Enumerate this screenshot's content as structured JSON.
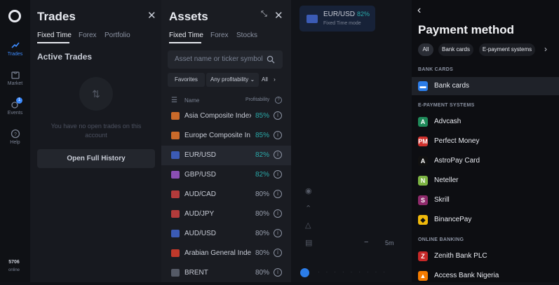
{
  "rail": {
    "items": [
      {
        "label": "Trades",
        "icon": "trades-icon"
      },
      {
        "label": "Market",
        "icon": "market-icon"
      },
      {
        "label": "Events",
        "icon": "events-icon",
        "badge": "1"
      },
      {
        "label": "Help",
        "icon": "help-icon"
      }
    ],
    "online_count": "5706",
    "online_label": "online"
  },
  "trades": {
    "title": "Trades",
    "tabs": [
      "Fixed Time",
      "Forex",
      "Portfolio"
    ],
    "section": "Active Trades",
    "empty_text": "You have no open trades on this account",
    "history_button": "Open Full History"
  },
  "assets": {
    "title": "Assets",
    "tabs": [
      "Fixed Time",
      "Forex",
      "Stocks"
    ],
    "search_placeholder": "Asset name or ticker symbol",
    "filters": [
      "Favorites",
      "Any profitability",
      "All"
    ],
    "col_name": "Name",
    "col_profit": "Profitability",
    "rows": [
      {
        "name": "Asia Composite Index",
        "pct": "85%",
        "color": "#c96a2a",
        "highlight": true
      },
      {
        "name": "Europe Composite In...",
        "pct": "85%",
        "color": "#c96a2a",
        "highlight": true
      },
      {
        "name": "EUR/USD",
        "pct": "82%",
        "color": "#3b5bb5",
        "highlight": true,
        "selected": true
      },
      {
        "name": "GBP/USD",
        "pct": "82%",
        "color": "#8a4fb3",
        "highlight": true
      },
      {
        "name": "AUD/CAD",
        "pct": "80%",
        "color": "#b33b3b",
        "highlight": false
      },
      {
        "name": "AUD/JPY",
        "pct": "80%",
        "color": "#b33b3b",
        "highlight": false
      },
      {
        "name": "AUD/USD",
        "pct": "80%",
        "color": "#3b5bb5",
        "highlight": false
      },
      {
        "name": "Arabian General Index",
        "pct": "80%",
        "color": "#c0392b",
        "highlight": false
      },
      {
        "name": "BRENT",
        "pct": "80%",
        "color": "#555a66",
        "highlight": false
      }
    ]
  },
  "chart": {
    "pair": "EUR/USD",
    "pair_pct": "82%",
    "mode": "Fixed Time mode",
    "timeframe": "5m",
    "zoom_minus": "−"
  },
  "payment": {
    "title": "Payment method",
    "chips": [
      "All",
      "Bank cards",
      "E-payment systems"
    ],
    "sections": {
      "bank": "BANK CARDS",
      "epay": "E-PAYMENT SYSTEMS",
      "online": "ONLINE BANKING"
    },
    "bank_items": [
      {
        "label": "Bank cards",
        "color": "#2b7de9",
        "glyph": "▬"
      }
    ],
    "epay_items": [
      {
        "label": "Advcash",
        "color": "#1f8a5a",
        "glyph": "A"
      },
      {
        "label": "Perfect Money",
        "color": "#d0312d",
        "glyph": "PM"
      },
      {
        "label": "AstroPay Card",
        "color": "#111111",
        "glyph": "A"
      },
      {
        "label": "Neteller",
        "color": "#7cb342",
        "glyph": "N"
      },
      {
        "label": "Skrill",
        "color": "#8e2a6b",
        "glyph": "S"
      },
      {
        "label": "BinancePay",
        "color": "#f0b90b",
        "glyph": "◆"
      }
    ],
    "online_items": [
      {
        "label": "Zenith Bank PLC",
        "color": "#c62828",
        "glyph": "Z"
      },
      {
        "label": "Access Bank Nigeria",
        "color": "#f57c00",
        "glyph": "▲"
      }
    ]
  }
}
